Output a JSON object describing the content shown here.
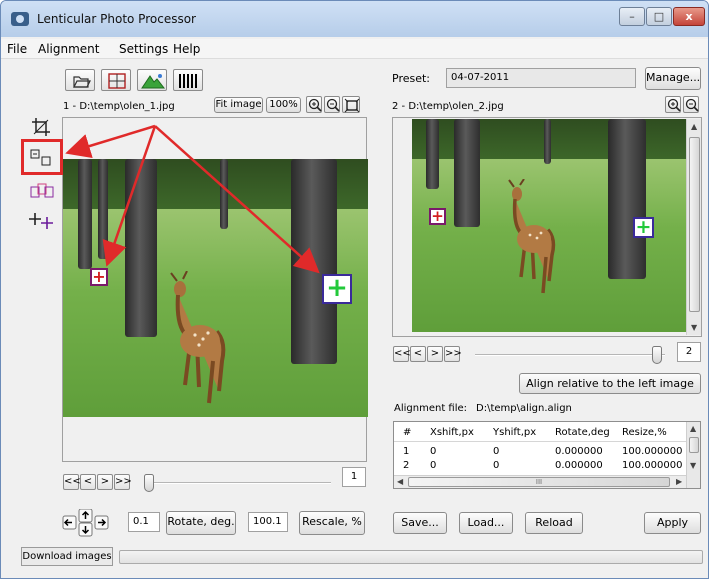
{
  "window": {
    "title": "Lenticular Photo Processor",
    "controls": {
      "minimize": "–",
      "maximize": "□",
      "close": "x"
    }
  },
  "menu": {
    "file": "File",
    "alignment": "Alignment",
    "settings": "Settings",
    "help": "Help"
  },
  "left_panel": {
    "image_label": "1 - D:\\temp\\olen_1.jpg",
    "fit_image": "Fit image",
    "zoom_100": "100%",
    "frame_count": "1",
    "rotate_value": "0.1",
    "rotate_button": "Rotate, deg.",
    "rescale_value": "100.1",
    "rescale_button": "Rescale, %"
  },
  "right_panel": {
    "preset_label": "Preset:",
    "preset_value": "04-07-2011",
    "manage_button": "Manage...",
    "image_label": "2 - D:\\temp\\olen_2.jpg",
    "frame_count": "2",
    "align_button": "Align relative to the left image",
    "alignment_file_label": "Alignment file:",
    "alignment_file_value": "D:\\temp\\align.align",
    "table": {
      "headers": [
        "#",
        "Xshift,px",
        "Yshift,px",
        "Rotate,deg",
        "Resize,%"
      ],
      "rows": [
        [
          "1",
          "0",
          "0",
          "0.000000",
          "100.000000"
        ],
        [
          "2",
          "0",
          "0",
          "0.000000",
          "100.000000"
        ]
      ],
      "scroll_mark": "III"
    },
    "save_button": "Save...",
    "load_button": "Load...",
    "reload_button": "Reload",
    "apply_button": "Apply"
  },
  "nav": {
    "first": "<<",
    "prev": "<",
    "next": ">",
    "last": ">>"
  },
  "status": {
    "tab": "Download images"
  },
  "colors": {
    "annotation": "#e02a2a",
    "marker_red": "#d42020",
    "marker_green": "#22c93a",
    "marker_border": "#3a2a9a"
  },
  "icons": [
    "open-folder-icon",
    "grid-icon",
    "mountain-icon",
    "barcode-icon",
    "zoom-in-icon",
    "zoom-out-icon",
    "fit-frame-icon",
    "crop-icon",
    "align-points-icon",
    "compare-icon",
    "crosshair-icon",
    "rotate-arrows-icon"
  ]
}
